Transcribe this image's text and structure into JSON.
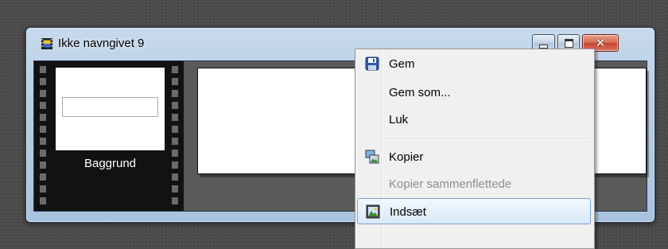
{
  "window": {
    "title": "Ikke navngivet 9",
    "title_icon": "film-document-icon",
    "controls": {
      "minimize": "minimize-icon",
      "maximize": "maximize-icon",
      "close": "close-icon"
    }
  },
  "layers": [
    {
      "name": "Baggrund"
    }
  ],
  "context_menu": {
    "items": [
      {
        "label": "Gem",
        "icon": "save-disk-icon",
        "enabled": true
      },
      {
        "label": "Gem som...",
        "icon": "",
        "enabled": true
      },
      {
        "label": "Luk",
        "icon": "",
        "enabled": true
      },
      {
        "label": "Kopier",
        "icon": "copy-image-icon",
        "enabled": true
      },
      {
        "label": "Kopier sammenflettede",
        "icon": "",
        "enabled": false
      },
      {
        "label": "Indsæt",
        "icon": "paste-image-icon",
        "enabled": true,
        "highlighted": true
      }
    ]
  },
  "colors": {
    "desktop": "#4b4b4b",
    "menu_highlight_border": "#7da2ce",
    "close_button": "#c2432a"
  }
}
